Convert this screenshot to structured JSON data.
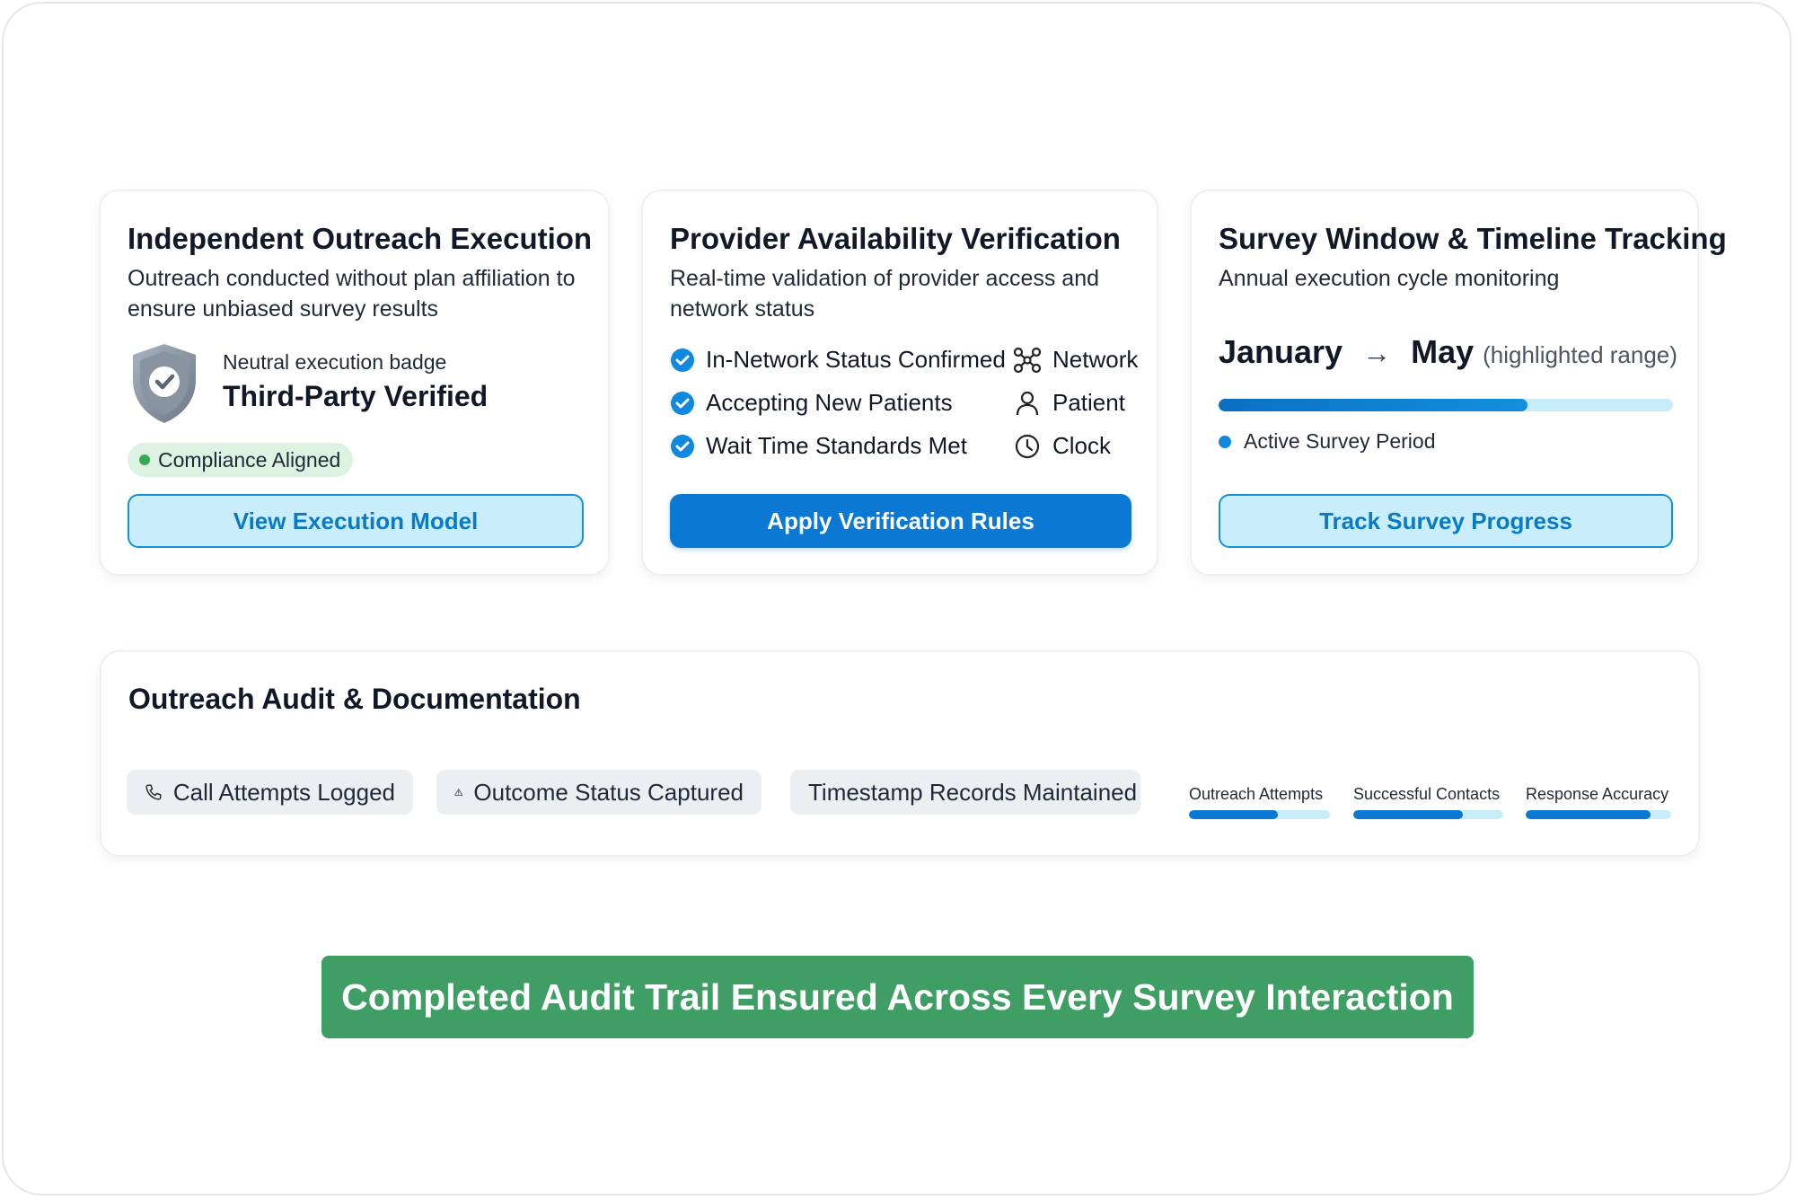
{
  "card1": {
    "title": "Independent Outreach Execution",
    "subtitle": "Outreach conducted without plan affiliation to ensure unbiased survey results",
    "badge_caption": "Neutral execution badge",
    "badge_title": "Third-Party Verified",
    "status_pill": "Compliance Aligned",
    "button": "View Execution Model"
  },
  "card2": {
    "title": "Provider Availability Verification",
    "subtitle": "Real-time validation of provider access and network status",
    "checks": [
      "In-Network Status Confirmed",
      "Accepting New Patients",
      "Wait Time Standards Met"
    ],
    "icon_labels": [
      "Network",
      "Patient",
      "Clock"
    ],
    "button": "Apply Verification Rules"
  },
  "card3": {
    "title": "Survey Window & Timeline Tracking",
    "subtitle": "Annual execution cycle monitoring",
    "range_start": "January",
    "range_end": "May",
    "range_note": "(highlighted range)",
    "progress_fraction": 0.68,
    "legend": "Active Survey Period",
    "button": "Track Survey Progress"
  },
  "audit": {
    "title": "Outreach Audit & Documentation",
    "chips": [
      "Call Attempts Logged",
      "Outcome Status Captured",
      "Timestamp Records Maintained"
    ],
    "metrics": [
      {
        "label": "Outreach Attempts",
        "fraction": 0.63
      },
      {
        "label": "Successful Contacts",
        "fraction": 0.73
      },
      {
        "label": "Response Accuracy",
        "fraction": 0.86
      }
    ]
  },
  "banner": "Completed Audit Trail Ensured Across Every Survey Interaction",
  "colors": {
    "accent_blue": "#0b78d4",
    "light_blue": "#c9edfa",
    "green_banner": "#3f9e63",
    "pill_green": "#dcf3e2"
  }
}
